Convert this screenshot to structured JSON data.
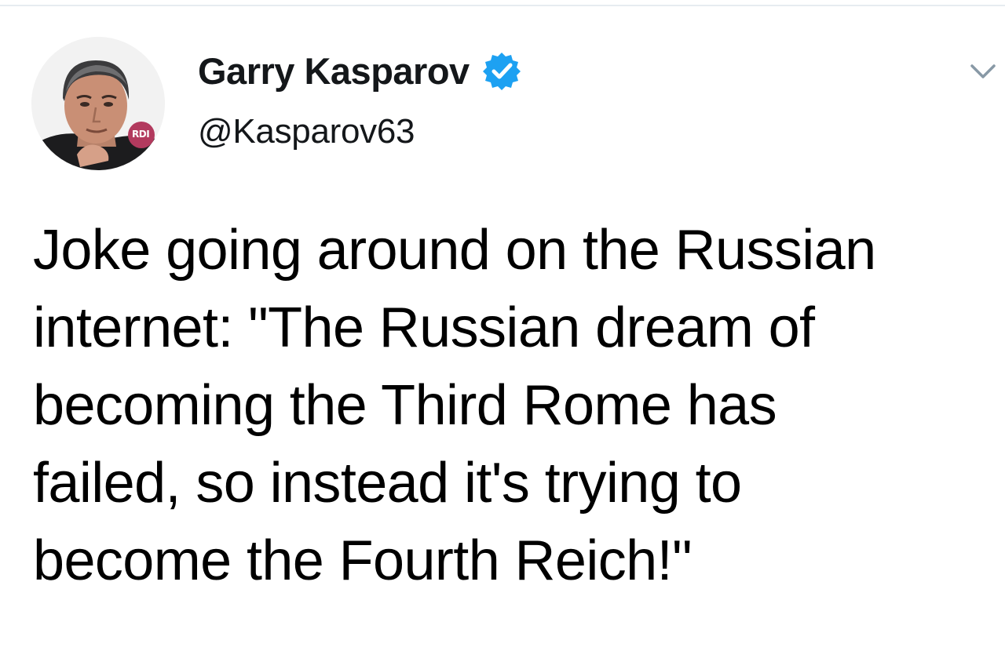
{
  "tweet": {
    "author": {
      "display_name": "Garry Kasparov",
      "handle": "@Kasparov63",
      "verified": true,
      "avatar_badge": "RDI"
    },
    "text_lines": [
      "Joke going around on the Russian",
      "internet: \"The Russian dream of",
      "becoming the Third Rome has",
      "failed, so instead it's trying to",
      "become the Fourth Reich!\""
    ]
  },
  "icons": {
    "verified": "verified-badge-icon",
    "menu": "chevron-down-icon"
  },
  "colors": {
    "verified_blue": "#1da1f2",
    "text": "#14171a",
    "chevron": "#8899a6",
    "border": "#e6ecf0"
  }
}
